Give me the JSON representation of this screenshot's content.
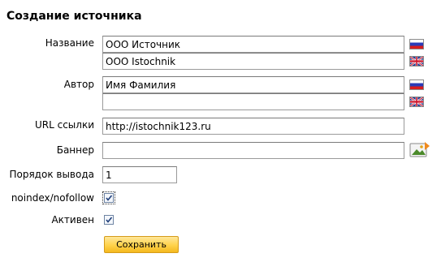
{
  "page_title": "Создание источника",
  "fields": {
    "name": {
      "label": "Название",
      "value_ru": "ООО Источник",
      "value_en": "OOO Istochnik"
    },
    "author": {
      "label": "Автор",
      "value_ru": "Имя Фамилия",
      "value_en": ""
    },
    "url": {
      "label": "URL ссылки",
      "value": "http://istochnik123.ru"
    },
    "banner": {
      "label": "Баннер",
      "value": ""
    },
    "order": {
      "label": "Порядок вывода",
      "value": "1"
    },
    "noindex": {
      "label": "noindex/nofollow",
      "checked": true
    },
    "active": {
      "label": "Активен",
      "checked": true
    }
  },
  "buttons": {
    "save_label": "Сохранить"
  },
  "icons": {
    "ru_flag": "russia-flag-icon",
    "uk_flag": "uk-flag-icon",
    "image_picker": "image-picker-icon"
  },
  "colors": {
    "button_top": "#ffe79a",
    "button_bottom": "#f4b81f",
    "button_border": "#d59b1a"
  }
}
